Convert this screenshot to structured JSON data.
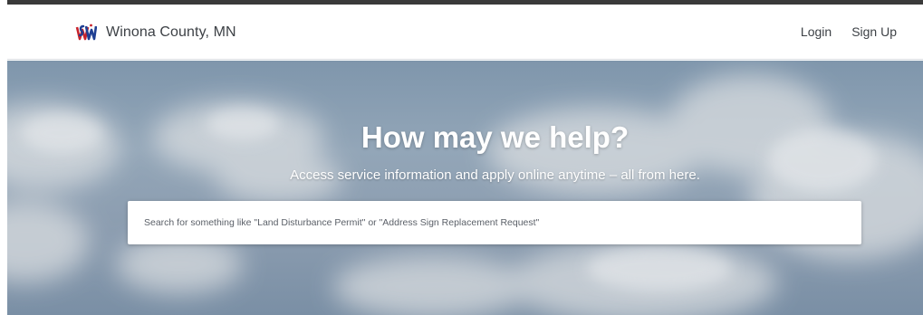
{
  "header": {
    "brand_logo_icon": "winona-county-seal-icon",
    "brand_name": "Winona County, MN",
    "login_label": "Login",
    "signup_label": "Sign Up"
  },
  "hero": {
    "title": "How may we help?",
    "subtitle": "Access service information and apply online anytime – all from here.",
    "search_placeholder": "Search for something like \"Land Disturbance Permit\" or \"Address Sign Replacement Request\"",
    "search_value": ""
  },
  "colors": {
    "header_bg": "#ffffff",
    "top_rule": "#3a3a3a",
    "nav_text": "#3d4146",
    "hero_sky": "#8a9db1",
    "hero_text": "#ffffff"
  }
}
